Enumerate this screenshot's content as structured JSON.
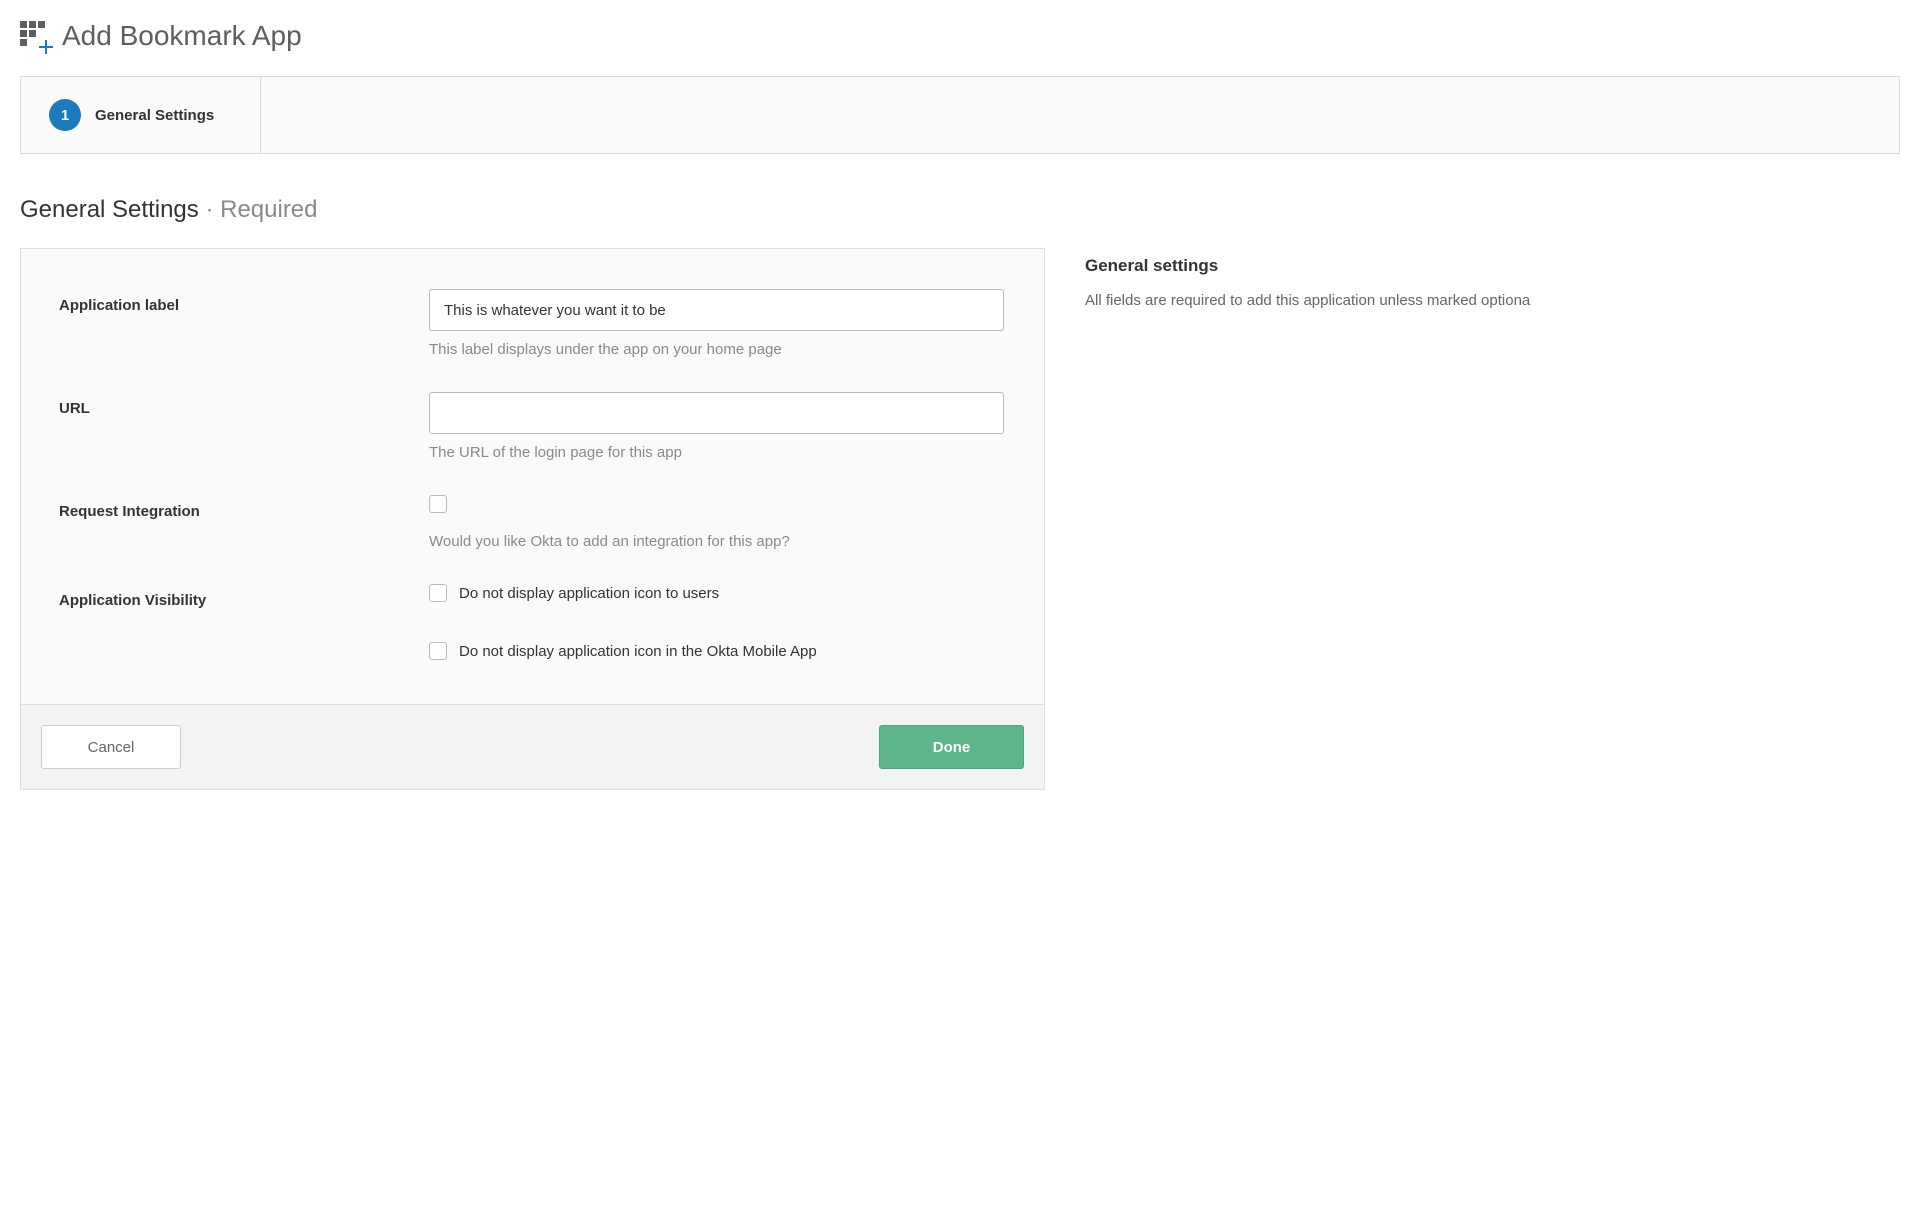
{
  "header": {
    "title": "Add Bookmark App"
  },
  "wizard": {
    "steps": [
      {
        "num": "1",
        "label": "General Settings"
      }
    ]
  },
  "section": {
    "title": "General Settings",
    "suffix": " · Required"
  },
  "form": {
    "app_label": {
      "label": "Application label",
      "value": "This is whatever you want it to be",
      "help": "This label displays under the app on your home page"
    },
    "url": {
      "label": "URL",
      "value": "",
      "help": "The URL of the login page for this app"
    },
    "request_integration": {
      "label": "Request Integration",
      "help": "Would you like Okta to add an integration for this app?"
    },
    "visibility": {
      "label": "Application Visibility",
      "opt1": "Do not display application icon to users",
      "opt2": "Do not display application icon in the Okta Mobile App"
    }
  },
  "buttons": {
    "cancel": "Cancel",
    "done": "Done"
  },
  "sidebar": {
    "title": "General settings",
    "text": "All fields are required to add this application unless marked optiona"
  }
}
